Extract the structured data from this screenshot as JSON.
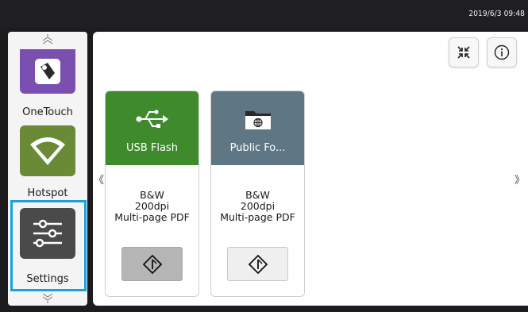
{
  "status_bar": {
    "clock": "2019/6/3 09:48"
  },
  "sidebar": {
    "items": [
      {
        "label": "OneTouch",
        "icon": "onetouch-icon",
        "color": "#7b4fb0"
      },
      {
        "label": "Hotspot",
        "icon": "wifi-icon",
        "color": "#6a8a35"
      },
      {
        "label": "Settings",
        "icon": "sliders-icon",
        "color": "#4a4a4a",
        "selected": true
      }
    ],
    "highlight_color": "#1ea0dc"
  },
  "toolbar": {
    "collapse_icon": "collapse-icon",
    "info_icon": "info-icon"
  },
  "navigation": {
    "prev": "《",
    "next": "》"
  },
  "cards": [
    {
      "title": "USB Flash",
      "icon": "usb-icon",
      "color": "#3f8a2d",
      "settings": [
        "B&W",
        "200dpi",
        "Multi-page PDF"
      ],
      "button_state": "pressed"
    },
    {
      "title": "Public Fo...",
      "icon": "network-folder-icon",
      "color": "#5f7785",
      "settings": [
        "B&W",
        "200dpi",
        "Multi-page PDF"
      ],
      "button_state": "normal"
    }
  ]
}
